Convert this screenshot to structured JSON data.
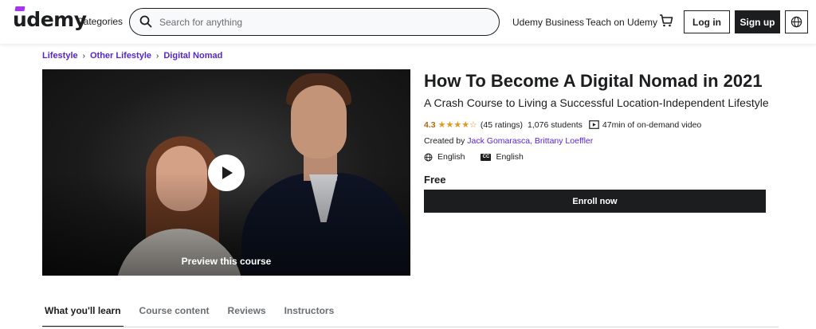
{
  "header": {
    "logo_text": "udemy",
    "categories_label": "Categories",
    "search_placeholder": "Search for anything",
    "search_value": "",
    "business_label": "Udemy Business",
    "teach_label": "Teach on Udemy",
    "login_label": "Log in",
    "signup_label": "Sign up",
    "icons": [
      "search-icon",
      "cart-icon",
      "globe-icon"
    ],
    "brand_color": "#a435f0"
  },
  "breadcrumb": {
    "items": [
      "Lifestyle",
      "Other Lifestyle",
      "Digital Nomad"
    ],
    "separator": "›",
    "color": "#5624d0"
  },
  "preview": {
    "label": "Preview this course",
    "icon": "play-icon"
  },
  "course": {
    "title": "How To Become A Digital Nomad in 2021",
    "subtitle": "A Crash Course to Living a Successful Location-Independent Lifestyle",
    "rating": "4.3",
    "stars": "★★★★☆",
    "ratings_count": "(45 ratings)",
    "students": "1,076 students",
    "video_length": "47min of on-demand video",
    "created_by_label": "Created by",
    "instructor_1": "Jack Gomarasca",
    "instructor_separator": ", ",
    "instructor_2": "Brittany Loeffler",
    "language": "English",
    "cc_label": "CC",
    "caption_language": "English",
    "price": "Free",
    "enroll_label": "Enroll now",
    "rating_color": "#b4690e",
    "star_color": "#e59819"
  },
  "tabs": [
    {
      "label": "What you'll learn",
      "active": true
    },
    {
      "label": "Course content",
      "active": false
    },
    {
      "label": "Reviews",
      "active": false
    },
    {
      "label": "Instructors",
      "active": false
    }
  ]
}
